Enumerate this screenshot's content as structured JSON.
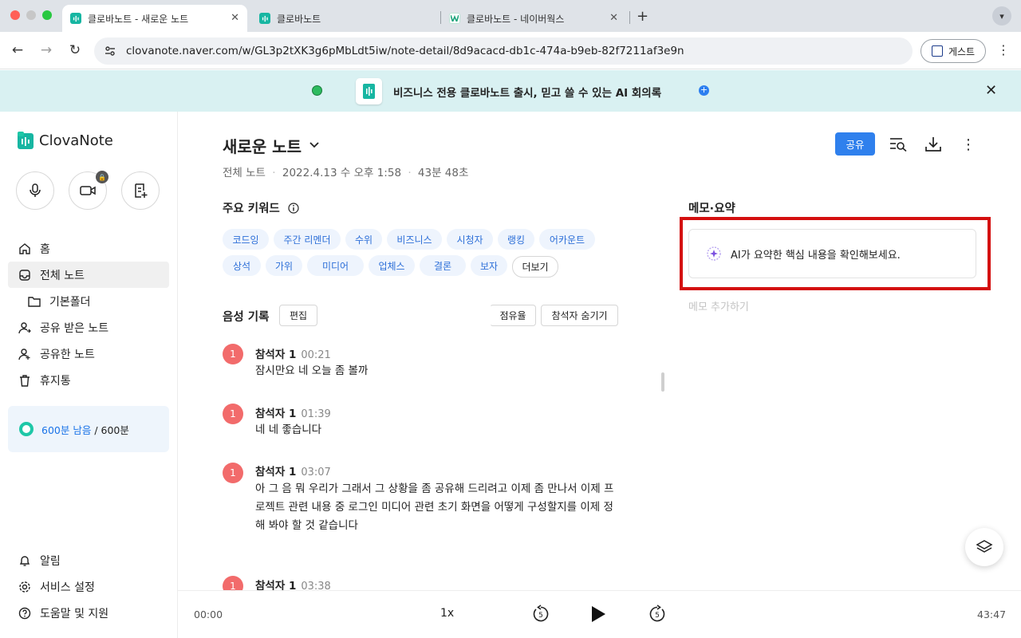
{
  "browser": {
    "tabs": [
      {
        "title": "클로바노트 - 새로운 노트",
        "active": true
      },
      {
        "title": "클로바노트",
        "active": false
      },
      {
        "title": "클로바노트 - 네이버웍스",
        "active": false
      }
    ],
    "url": "clovanote.naver.com/w/GL3p2tXK3g6pMbLdt5iw/note-detail/8d9acacd-db1c-474a-b9eb-82f7211af3e9n",
    "profile_label": "게스트"
  },
  "banner": {
    "text": "비즈니스 전용 클로바노트 출시, 믿고 쓸 수 있는 AI 회의록",
    "bg_color": "#d9f1f2"
  },
  "sidebar": {
    "logo_text": "ClovaNote",
    "nav": [
      {
        "label": "홈",
        "icon": "home-icon"
      },
      {
        "label": "전체 노트",
        "icon": "inbox-icon",
        "active": true
      },
      {
        "label": "기본폴더",
        "icon": "folder-icon"
      },
      {
        "label": "공유 받은 노트",
        "icon": "shared-user-icon"
      },
      {
        "label": "공유한 노트",
        "icon": "share-user-icon"
      },
      {
        "label": "휴지통",
        "icon": "trash-icon"
      }
    ],
    "quota": {
      "remaining": "600분 남음",
      "total": "/ 600분"
    },
    "bottom": [
      {
        "label": "알림",
        "icon": "bell-icon"
      },
      {
        "label": "서비스 설정",
        "icon": "gear-icon"
      },
      {
        "label": "도움말 및 지원",
        "icon": "help-icon"
      }
    ]
  },
  "note": {
    "title": "새로운 노트",
    "meta_folder": "전체 노트",
    "meta_date": "2022.4.13 수 오후 1:58",
    "meta_duration": "43분 48초",
    "share_label": "공유"
  },
  "keywords": {
    "title": "주요 키워드",
    "items": [
      "코드잉",
      "주간 리멘더",
      "수위",
      "비즈니스",
      "시청자",
      "랭킹",
      "어카운트",
      "상석",
      "가위",
      "미디어",
      "업체스",
      "결론",
      "보자"
    ],
    "more_label": "더보기"
  },
  "transcript": {
    "title": "음성 기록",
    "edit_label": "편집",
    "share_label": "점유율",
    "hide_label": "참석자 숨기기",
    "entries": [
      {
        "badge": "1",
        "speaker": "참석자 1",
        "time": "00:21",
        "text": "잠시만요 네 오늘 좀 볼까"
      },
      {
        "badge": "1",
        "speaker": "참석자 1",
        "time": "01:39",
        "text": "네 네 좋습니다"
      },
      {
        "badge": "1",
        "speaker": "참석자 1",
        "time": "03:07",
        "text": "아 그 음 뭐 우리가 그래서 그 상황을 좀 공유해 드리려고 이제 좀 만나서 이제 프로젝트 관련 내용 중 로그인 미디어 관련 초기 화면을 어떻게 구성할지를 이제 정해 봐야 할 것 같습니다"
      },
      {
        "badge": "1",
        "speaker": "참석자 1",
        "time": "03:38",
        "text": ""
      }
    ]
  },
  "memo": {
    "title": "메모·요약",
    "ai_prompt": "AI가 요약한 핵심 내용을 확인해보세요.",
    "add_placeholder": "메모 추가하기",
    "highlight_color": "#d40f0f"
  },
  "player": {
    "current": "00:00",
    "speed": "1x",
    "total": "43:47",
    "skip_seconds": "5"
  }
}
